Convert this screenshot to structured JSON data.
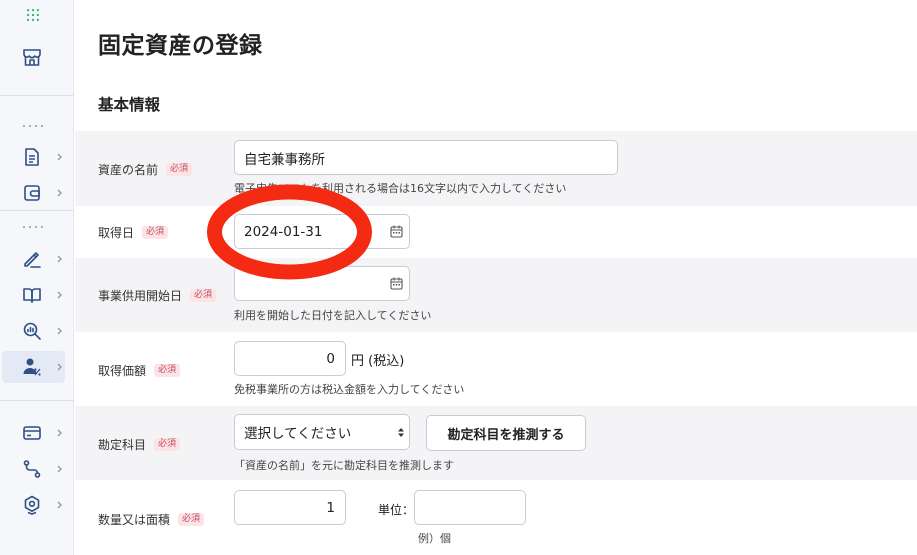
{
  "page": {
    "title": "固定資産の登録",
    "section": "基本情報"
  },
  "sidebar": {
    "items": [
      {
        "id": "apps",
        "icon": "apps-grid-icon"
      },
      {
        "id": "store",
        "icon": "store-icon"
      },
      {
        "id": "documents",
        "icon": "document-icon"
      },
      {
        "id": "wallet",
        "icon": "wallet-icon"
      },
      {
        "id": "signature",
        "icon": "pen-signature-icon"
      },
      {
        "id": "ledger",
        "icon": "book-icon"
      },
      {
        "id": "analysis",
        "icon": "chart-search-icon"
      },
      {
        "id": "user-percent",
        "icon": "user-percent-icon",
        "active": true
      },
      {
        "id": "card",
        "icon": "credit-card-icon"
      },
      {
        "id": "flow",
        "icon": "route-icon"
      },
      {
        "id": "settings",
        "icon": "settings-hex-icon"
      }
    ]
  },
  "form": {
    "required_badge": "必須",
    "asset_name": {
      "label": "資産の名前",
      "value": "自宅兼事務所",
      "help": "電子申告ソフトを利用される場合は16文字以内で入力してください"
    },
    "acquisition_date": {
      "label": "取得日",
      "value": "2024-01-31"
    },
    "service_start_date": {
      "label": "事業供用開始日",
      "value": "",
      "help": "利用を開始した日付を記入してください"
    },
    "acquisition_price": {
      "label": "取得価額",
      "value": "0",
      "unit": "円 (税込)",
      "help": "免税事業所の方は税込金額を入力してください"
    },
    "account": {
      "label": "勘定科目",
      "selected": "選択してください",
      "guess_button": "勘定科目を推測する",
      "help": "「資産の名前」を元に勘定科目を推測します"
    },
    "quantity": {
      "label": "数量又は面積",
      "value": "1",
      "unit_label": "単位：",
      "unit_value": "",
      "unit_help": "例）個"
    }
  },
  "colors": {
    "sidebar_bg": "#f6f7fa",
    "row_shade": "#f4f4f6",
    "required_text": "#c44c5d",
    "required_bg": "#fbe3e6",
    "annotation_red": "#f42a13",
    "icon_blue": "#2f4f86"
  }
}
